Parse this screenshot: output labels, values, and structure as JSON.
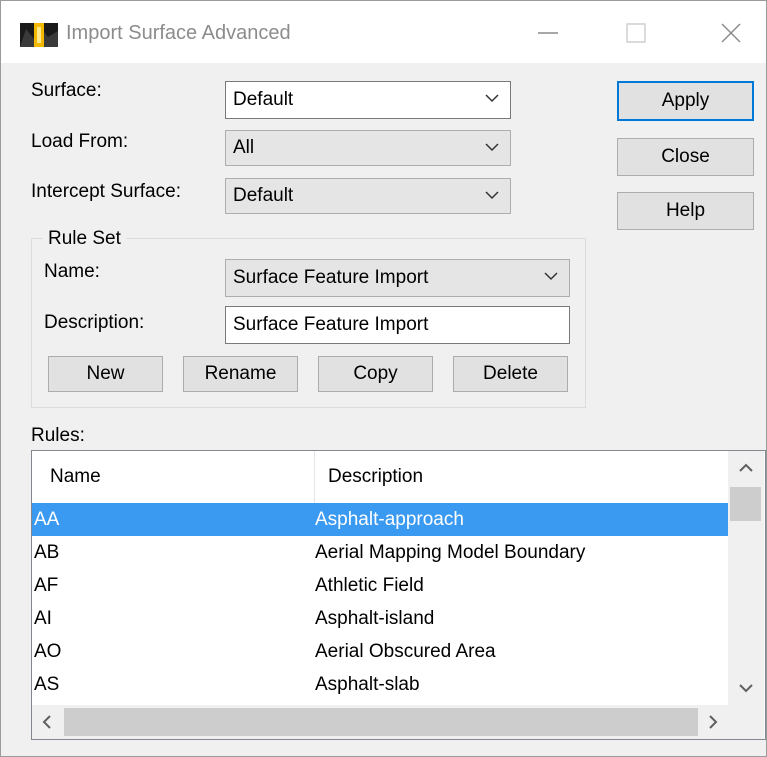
{
  "window": {
    "title": "Import Surface Advanced",
    "icon": "app-surface-icon"
  },
  "form": {
    "surface": {
      "label": "Surface:",
      "value": "Default"
    },
    "load_from": {
      "label": "Load From:",
      "value": "All"
    },
    "intercept_surface": {
      "label": "Intercept Surface:",
      "value": "Default"
    }
  },
  "actions": {
    "apply": "Apply",
    "close": "Close",
    "help": "Help"
  },
  "rule_set": {
    "title": "Rule Set",
    "name_label": "Name:",
    "name_value": "Surface Feature Import",
    "description_label": "Description:",
    "description_value": "Surface Feature Import",
    "buttons": {
      "new": "New",
      "rename": "Rename",
      "copy": "Copy",
      "delete": "Delete"
    }
  },
  "rules": {
    "label": "Rules:",
    "columns": [
      "Name",
      "Description"
    ],
    "rows": [
      {
        "name": "AA",
        "description": "Asphalt-approach",
        "selected": true
      },
      {
        "name": "AB",
        "description": "Aerial Mapping Model Boundary"
      },
      {
        "name": "AF",
        "description": "Athletic Field"
      },
      {
        "name": "AI",
        "description": "Asphalt-island"
      },
      {
        "name": "AO",
        "description": "Aerial Obscured Area"
      },
      {
        "name": "AS",
        "description": "Asphalt-slab"
      }
    ]
  },
  "colors": {
    "selection": "#3a99f0",
    "dialog_bg": "#f0f0f0",
    "title_text": "#8c8c8c"
  }
}
